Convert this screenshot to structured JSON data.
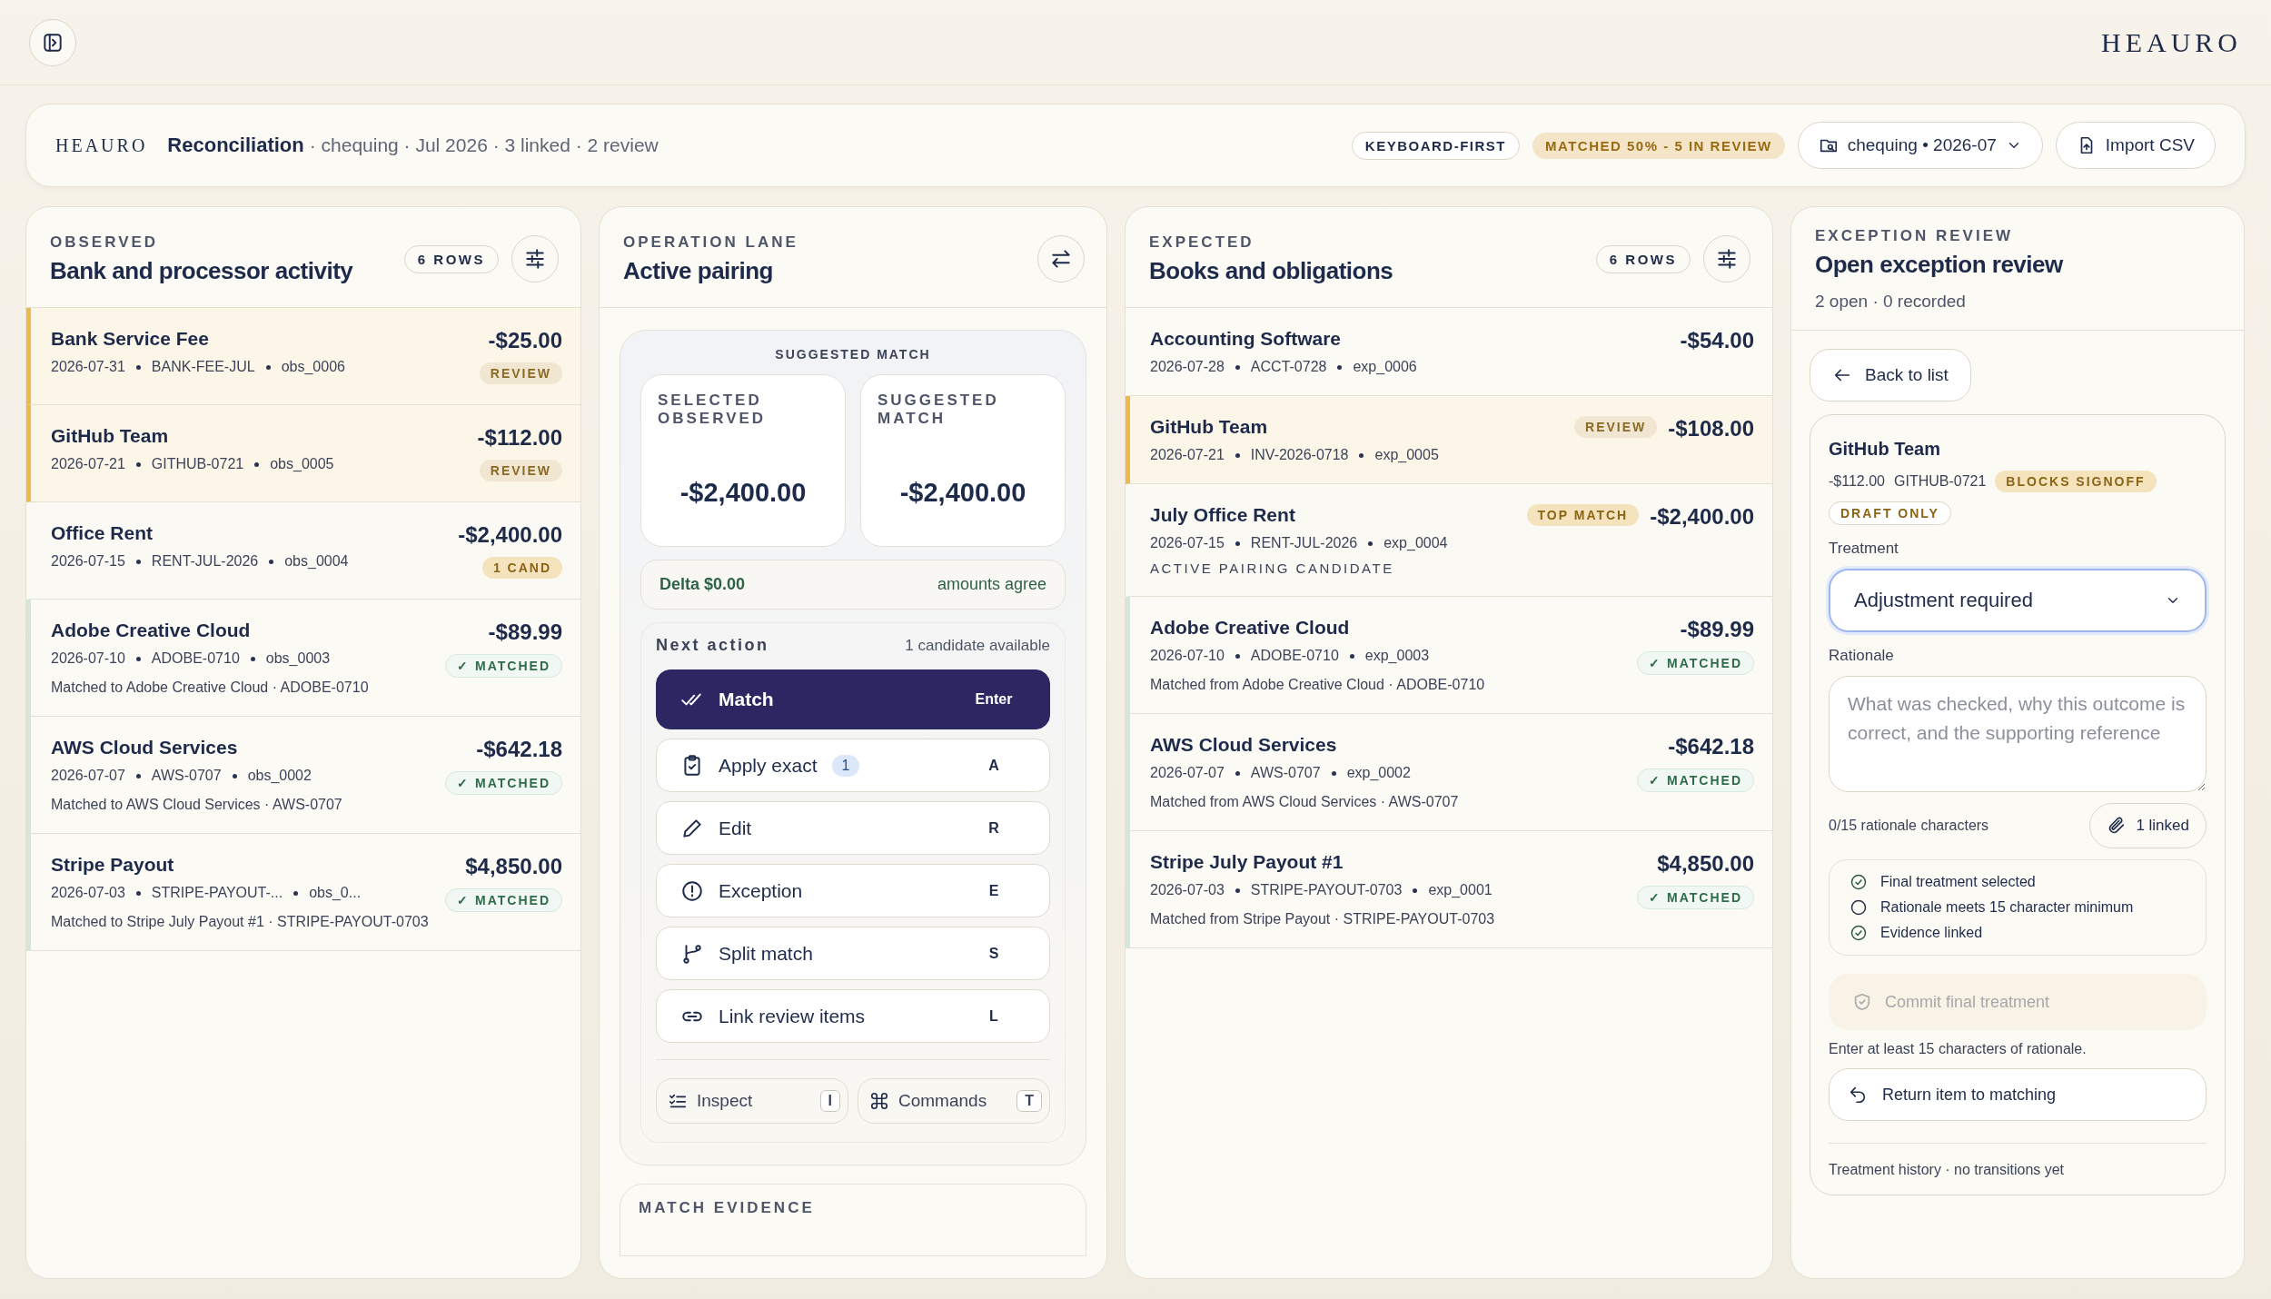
{
  "brand": "HEAURO",
  "header": {
    "brand": "HEAURO",
    "title": "Reconciliation",
    "subtitle": "· chequing · Jul 2026 · 3 linked · 2 review",
    "chips": [
      {
        "label": "KEYBOARD-FIRST",
        "kind": "outline"
      },
      {
        "label": "MATCHED 50% - 5 IN REVIEW",
        "kind": "warn"
      }
    ],
    "account": "chequing • 2026-07",
    "import": "Import CSV"
  },
  "observed": {
    "eyebrow": "OBSERVED",
    "title": "Bank and processor activity",
    "count": "6 ROWS",
    "rows": [
      {
        "name": "Bank Service Fee",
        "amount": "-$25.00",
        "meta": [
          "2026-07-31",
          "BANK-FEE-JUL",
          "obs_0006"
        ],
        "badge": "REVIEW",
        "kind": "review"
      },
      {
        "name": "GitHub Team",
        "amount": "-$112.00",
        "meta": [
          "2026-07-21",
          "GITHUB-0721",
          "obs_0005"
        ],
        "badge": "REVIEW",
        "kind": "review"
      },
      {
        "name": "Office Rent",
        "amount": "-$2,400.00",
        "meta": [
          "2026-07-15",
          "RENT-JUL-2026",
          "obs_0004"
        ],
        "badge": "1 CAND",
        "kind": "candidate"
      },
      {
        "name": "Adobe Creative Cloud",
        "amount": "-$89.99",
        "meta": [
          "2026-07-10",
          "ADOBE-0710",
          "obs_0003"
        ],
        "badge": "✓ MATCHED",
        "kind": "matched",
        "note": "Matched to Adobe Creative Cloud · ADOBE-0710"
      },
      {
        "name": "AWS Cloud Services",
        "amount": "-$642.18",
        "meta": [
          "2026-07-07",
          "AWS-0707",
          "obs_0002"
        ],
        "badge": "✓ MATCHED",
        "kind": "matched",
        "note": "Matched to AWS Cloud Services · AWS-0707"
      },
      {
        "name": "Stripe Payout",
        "amount": "$4,850.00",
        "meta": [
          "2026-07-03",
          "STRIPE-PAYOUT-...",
          "obs_0..."
        ],
        "badge": "✓ MATCHED",
        "kind": "matched",
        "note": "Matched to Stripe July Payout #1 · STRIPE-PAYOUT-0703"
      }
    ]
  },
  "operation": {
    "eyebrow": "OPERATION LANE",
    "title": "Active pairing",
    "suggested_label": "SUGGESTED MATCH",
    "amounts": [
      {
        "label": "SELECTED OBSERVED",
        "value": "-$2,400.00"
      },
      {
        "label": "SUGGESTED MATCH",
        "value": "-$2,400.00"
      }
    ],
    "delta": "Delta $0.00",
    "delta_note": "amounts agree",
    "next_label": "Next action",
    "next_note": "1 candidate available",
    "actions": [
      {
        "label": "Match",
        "key": "Enter",
        "selected": true
      },
      {
        "label": "Apply exact",
        "key": "A",
        "selected": false,
        "count": "1"
      },
      {
        "label": "Edit",
        "key": "R",
        "selected": false
      },
      {
        "label": "Exception",
        "key": "E",
        "selected": false
      },
      {
        "label": "Split match",
        "key": "S",
        "selected": false
      },
      {
        "label": "Link review items",
        "key": "L",
        "selected": false
      }
    ],
    "tools": [
      {
        "label": "Inspect",
        "key": "I"
      },
      {
        "label": "Commands",
        "key": "T"
      }
    ],
    "evidence_title": "MATCH EVIDENCE"
  },
  "expected": {
    "eyebrow": "EXPECTED",
    "title": "Books and obligations",
    "count": "6 ROWS",
    "rows": [
      {
        "name": "Accounting Software",
        "amount": "-$54.00",
        "meta": [
          "2026-07-28",
          "ACCT-0728",
          "exp_0006"
        ],
        "kind": "plain"
      },
      {
        "name": "GitHub Team",
        "amount": "-$108.00",
        "meta": [
          "2026-07-21",
          "INV-2026-0718",
          "exp_0005"
        ],
        "badge": "REVIEW",
        "kind": "review"
      },
      {
        "name": "July Office Rent",
        "amount": "-$2,400.00",
        "meta": [
          "2026-07-15",
          "RENT-JUL-2026",
          "exp_0004"
        ],
        "badge": "TOP MATCH",
        "kind": "candidate",
        "caption": "ACTIVE PAIRING CANDIDATE"
      },
      {
        "name": "Adobe Creative Cloud",
        "amount": "-$89.99",
        "meta": [
          "2026-07-10",
          "ADOBE-0710",
          "exp_0003"
        ],
        "badge": "✓ MATCHED",
        "kind": "matched",
        "note": "Matched from Adobe Creative Cloud · ADOBE-0710"
      },
      {
        "name": "AWS Cloud Services",
        "amount": "-$642.18",
        "meta": [
          "2026-07-07",
          "AWS-0707",
          "exp_0002"
        ],
        "badge": "✓ MATCHED",
        "kind": "matched",
        "note": "Matched from AWS Cloud Services · AWS-0707"
      },
      {
        "name": "Stripe July Payout #1",
        "amount": "$4,850.00",
        "meta": [
          "2026-07-03",
          "STRIPE-PAYOUT-0703",
          "exp_0001"
        ],
        "badge": "✓ MATCHED",
        "kind": "matched",
        "note": "Matched from Stripe Payout · STRIPE-PAYOUT-0703"
      }
    ]
  },
  "exception": {
    "eyebrow": "EXCEPTION REVIEW",
    "title": "Open exception review",
    "summary": "2 open · 0 recorded",
    "back": "Back to list",
    "item": {
      "name": "GitHub Team",
      "amount": "-$112.00",
      "ref": "GITHUB-0721",
      "tags": [
        "BLOCKS SIGNOFF",
        "DRAFT ONLY"
      ]
    },
    "treatment_label": "Treatment",
    "treatment": "Adjustment required",
    "rationale_label": "Rationale",
    "rationale_placeholder": "What was checked, why this outcome is correct, and the supporting reference",
    "char_count": "0/15 rationale characters",
    "linked": "1 linked",
    "checklist": [
      {
        "label": "Final treatment selected",
        "checked": true
      },
      {
        "label": "Rationale meets 15 character minimum",
        "checked": false
      },
      {
        "label": "Evidence linked",
        "checked": true
      }
    ],
    "commit": {
      "label": "Commit final treatment",
      "disabled": true
    },
    "hint": "Enter at least 15 characters of rationale.",
    "return": "Return item to matching",
    "history": "Treatment history · no transitions yet"
  }
}
